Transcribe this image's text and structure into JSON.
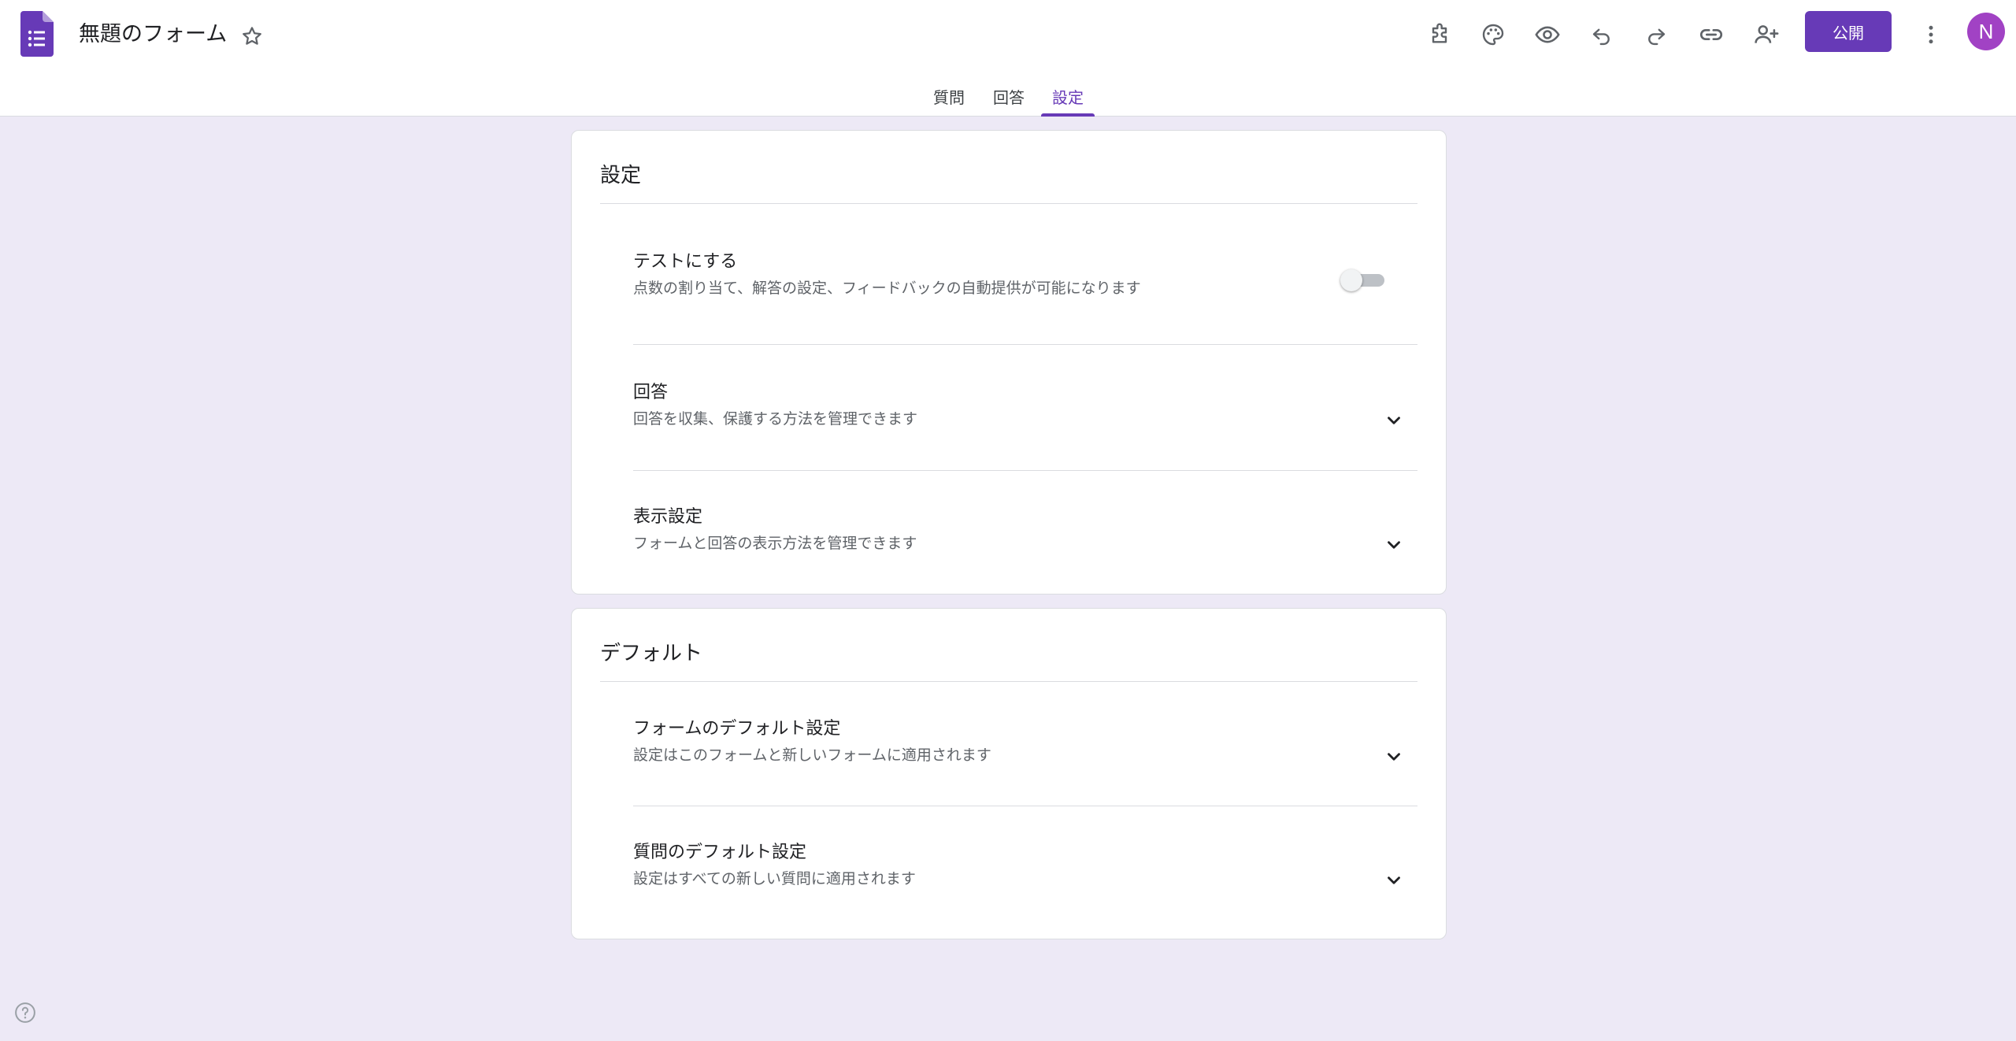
{
  "header": {
    "title": "無題のフォーム",
    "publish_label": "公開",
    "avatar_initial": "N",
    "accent": "#673ab7",
    "avatar_color": "#a142c4"
  },
  "toolbar": {
    "icons": [
      "addon-icon",
      "palette-icon",
      "preview-eye-icon",
      "undo-icon",
      "redo-icon",
      "link-icon",
      "add-collaborator-icon",
      "more-vert-icon"
    ]
  },
  "tabs": [
    {
      "label": "質問"
    },
    {
      "label": "回答"
    },
    {
      "label": "設定"
    }
  ],
  "active_tab": "設定",
  "settings_card": {
    "title": "設定",
    "rows": [
      {
        "title": "テストにする",
        "desc": "点数の割り当て、解答の設定、フィードバックの自動提供が可能になります",
        "control": "toggle",
        "enabled": false
      },
      {
        "title": "回答",
        "desc": "回答を収集、保護する方法を管理できます",
        "control": "chevron"
      },
      {
        "title": "表示設定",
        "desc": "フォームと回答の表示方法を管理できます",
        "control": "chevron"
      }
    ]
  },
  "defaults_card": {
    "title": "デフォルト",
    "rows": [
      {
        "title": "フォームのデフォルト設定",
        "desc": "設定はこのフォームと新しいフォームに適用されます",
        "control": "chevron"
      },
      {
        "title": "質問のデフォルト設定",
        "desc": "設定はすべての新しい質問に適用されます",
        "control": "chevron"
      }
    ]
  }
}
